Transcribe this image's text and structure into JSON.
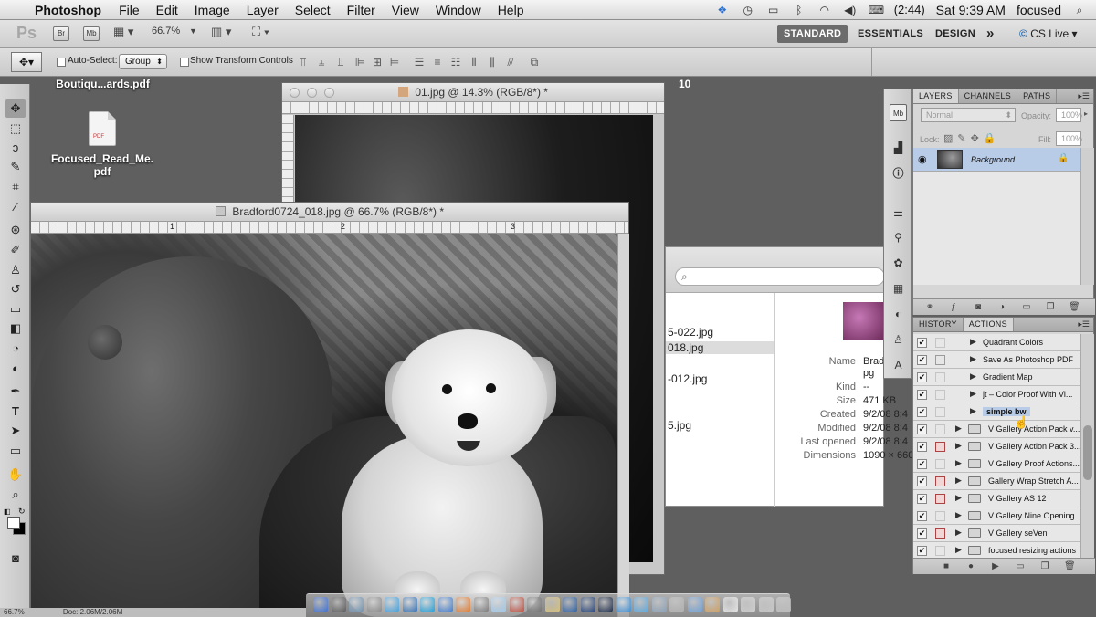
{
  "menubar": {
    "app_name": "Photoshop",
    "items": [
      "File",
      "Edit",
      "Image",
      "Layer",
      "Select",
      "Filter",
      "View",
      "Window",
      "Help"
    ],
    "battery": "(2:44)",
    "clock": "Sat 9:39 AM",
    "user": "focused"
  },
  "appbar": {
    "logo": "Ps",
    "br": "Br",
    "mb": "Mb",
    "zoom": "66.7%",
    "workspaces": [
      "STANDARD",
      "ESSENTIALS",
      "DESIGN"
    ],
    "active_workspace": "STANDARD",
    "more": "»",
    "cs_live": "CS Live"
  },
  "options": {
    "auto_select_label": "Auto-Select:",
    "auto_select_value": "Group",
    "transform_label": "Show Transform Controls"
  },
  "desktop": {
    "file1": "Boutiqu...ards.pdf",
    "file2_line1": "Focused_Read_Me.",
    "file2_line2": "pdf",
    "stray_number": "10"
  },
  "doc1": {
    "title": "01.jpg @ 14.3% (RGB/8*) *"
  },
  "doc2": {
    "title": "Bradford0724_018.jpg @ 66.7% (RGB/8*) *",
    "ruler_marks": [
      "1",
      "2",
      "3"
    ]
  },
  "statusbar": {
    "zoom": "66.7%",
    "doc": "Doc: 2.06M/2.06M"
  },
  "finder": {
    "files": [
      "5-022.jpg",
      "018.jpg",
      "-012.jpg",
      "5.jpg"
    ],
    "selected_file": "018.jpg",
    "info": {
      "name_label": "Name",
      "name_value": "Brad",
      "name_value2": "pg",
      "kind_label": "Kind",
      "kind_value": "--",
      "size_label": "Size",
      "size_value": "471 KB",
      "created_label": "Created",
      "created_value": "9/2/08 8:4",
      "modified_label": "Modified",
      "modified_value": "9/2/08 8:4",
      "opened_label": "Last opened",
      "opened_value": "9/2/08 8:4",
      "dims_label": "Dimensions",
      "dims_value": "1090 × 660"
    }
  },
  "layers_panel": {
    "tabs": [
      "LAYERS",
      "CHANNELS",
      "PATHS"
    ],
    "active_tab": "LAYERS",
    "blend_mode": "Normal",
    "opacity_label": "Opacity:",
    "opacity_value": "100%",
    "lock_label": "Lock:",
    "fill_label": "Fill:",
    "fill_value": "100%",
    "layer_name": "Background"
  },
  "actions_panel": {
    "tabs": [
      "HISTORY",
      "ACTIONS"
    ],
    "active_tab": "ACTIONS",
    "rows": [
      {
        "label": "Quadrant Colors",
        "type": "action",
        "dialog": false
      },
      {
        "label": "Save As Photoshop PDF",
        "type": "action",
        "dialog": true
      },
      {
        "label": "Gradient Map",
        "type": "action",
        "dialog": false
      },
      {
        "label": "jt – Color Proof With Vi...",
        "type": "action",
        "dialog": false
      },
      {
        "label": "simple bw",
        "type": "action",
        "dialog": false,
        "selected": true
      },
      {
        "label": "V Gallery Action Pack v...",
        "type": "set",
        "dialog": false
      },
      {
        "label": "V Gallery Action Pack 3...",
        "type": "set",
        "dialog": true
      },
      {
        "label": "V Gallery Proof Actions...",
        "type": "set",
        "dialog": false
      },
      {
        "label": "Gallery Wrap Stretch A...",
        "type": "set",
        "dialog": true
      },
      {
        "label": "V Gallery AS 12",
        "type": "set",
        "dialog": true
      },
      {
        "label": "V Gallery Nine Opening",
        "type": "set",
        "dialog": false
      },
      {
        "label": "V Gallery seVen",
        "type": "set",
        "dialog": true
      },
      {
        "label": "focused resizing actions",
        "type": "set",
        "dialog": false
      }
    ]
  },
  "icons": {
    "apple": "apple-icon",
    "move_tool": "move-tool-icon",
    "eye": "eye-icon",
    "lock": "lock-icon"
  }
}
